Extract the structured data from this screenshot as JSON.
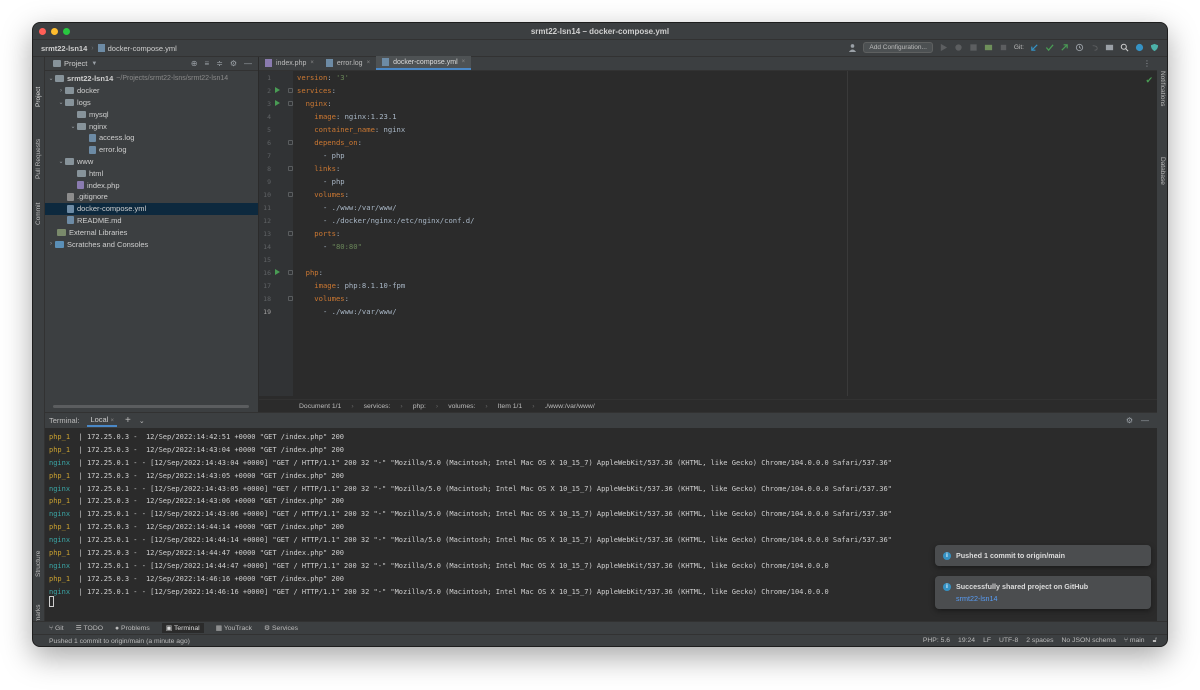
{
  "window": {
    "title": "srmt22-lsn14 – docker-compose.yml"
  },
  "navbar": {
    "project": "srmt22-lsn14",
    "file": "docker-compose.yml",
    "add_configuration": "Add Configuration...",
    "git_label": "Git:"
  },
  "side_tabs": {
    "left_top": [
      "Project",
      "Pull Requests",
      "Commit"
    ],
    "left_bottom": [
      "Structure",
      "Bookmarks"
    ],
    "right": [
      "Notifications",
      "Database"
    ]
  },
  "project_panel": {
    "title": "Project",
    "root": {
      "name": "srmt22-lsn14",
      "path": "~/Projects/srmt22-lsns/srmt22-lsn14"
    },
    "items": [
      "docker",
      "logs",
      "mysql",
      "nginx",
      "access.log",
      "error.log",
      "www",
      "html",
      "index.php",
      ".gitignore",
      "docker-compose.yml",
      "README.md",
      "External Libraries",
      "Scratches and Consoles"
    ]
  },
  "editor_tabs": [
    "index.php",
    "error.log",
    "docker-compose.yml"
  ],
  "code_lines": [
    {
      "n": "1",
      "a": "version",
      "b": ": ",
      "c": "'3'"
    },
    {
      "n": "2",
      "a": "services",
      "b": ":",
      "c": ""
    },
    {
      "n": "3",
      "a": "  nginx",
      "b": ":",
      "c": ""
    },
    {
      "n": "4",
      "a": "    image",
      "b": ": ",
      "c": "nginx:1.23.1"
    },
    {
      "n": "5",
      "a": "    container_name",
      "b": ": ",
      "c": "nginx"
    },
    {
      "n": "6",
      "a": "    depends_on",
      "b": ":",
      "c": ""
    },
    {
      "n": "7",
      "a": "",
      "b": "      - ",
      "c": "php"
    },
    {
      "n": "8",
      "a": "    links",
      "b": ":",
      "c": ""
    },
    {
      "n": "9",
      "a": "",
      "b": "      - ",
      "c": "php"
    },
    {
      "n": "10",
      "a": "    volumes",
      "b": ":",
      "c": ""
    },
    {
      "n": "11",
      "a": "",
      "b": "      - ",
      "c": "./www:/var/www/"
    },
    {
      "n": "12",
      "a": "",
      "b": "      - ",
      "c": "./docker/nginx:/etc/nginx/conf.d/"
    },
    {
      "n": "13",
      "a": "    ports",
      "b": ":",
      "c": ""
    },
    {
      "n": "14",
      "a": "",
      "b": "      - ",
      "c": "\"80:80\""
    },
    {
      "n": "15",
      "a": "",
      "b": "",
      "c": ""
    },
    {
      "n": "16",
      "a": "  php",
      "b": ":",
      "c": ""
    },
    {
      "n": "17",
      "a": "    image",
      "b": ": ",
      "c": "php:8.1.10-fpm"
    },
    {
      "n": "18",
      "a": "    volumes",
      "b": ":",
      "c": ""
    },
    {
      "n": "19",
      "a": "",
      "b": "      - ",
      "c": "./www:/var/www/"
    }
  ],
  "breadcrumbs": [
    "Document 1/1",
    "services:",
    "php:",
    "volumes:",
    "Item 1/1",
    "./www:/var/www/"
  ],
  "terminal": {
    "label": "Terminal:",
    "tab": "Local",
    "lines": [
      {
        "svc": "php_1",
        "text": " | 172.25.0.3 -  12/Sep/2022:14:42:51 +0000 \"GET /index.php\" 200"
      },
      {
        "svc": "php_1",
        "text": " | 172.25.0.3 -  12/Sep/2022:14:43:04 +0000 \"GET /index.php\" 200"
      },
      {
        "svc": "nginx",
        "text": " | 172.25.0.1 - - [12/Sep/2022:14:43:04 +0000] \"GET / HTTP/1.1\" 200 32 \"-\" \"Mozilla/5.0 (Macintosh; Intel Mac OS X 10_15_7) AppleWebKit/537.36 (KHTML, like Gecko) Chrome/104.0.0.0 Safari/537.36\""
      },
      {
        "svc": "php_1",
        "text": " | 172.25.0.3 -  12/Sep/2022:14:43:05 +0000 \"GET /index.php\" 200"
      },
      {
        "svc": "nginx",
        "text": " | 172.25.0.1 - - [12/Sep/2022:14:43:05 +0000] \"GET / HTTP/1.1\" 200 32 \"-\" \"Mozilla/5.0 (Macintosh; Intel Mac OS X 10_15_7) AppleWebKit/537.36 (KHTML, like Gecko) Chrome/104.0.0.0 Safari/537.36\""
      },
      {
        "svc": "php_1",
        "text": " | 172.25.0.3 -  12/Sep/2022:14:43:06 +0000 \"GET /index.php\" 200"
      },
      {
        "svc": "nginx",
        "text": " | 172.25.0.1 - - [12/Sep/2022:14:43:06 +0000] \"GET / HTTP/1.1\" 200 32 \"-\" \"Mozilla/5.0 (Macintosh; Intel Mac OS X 10_15_7) AppleWebKit/537.36 (KHTML, like Gecko) Chrome/104.0.0.0 Safari/537.36\""
      },
      {
        "svc": "php_1",
        "text": " | 172.25.0.3 -  12/Sep/2022:14:44:14 +0000 \"GET /index.php\" 200"
      },
      {
        "svc": "nginx",
        "text": " | 172.25.0.1 - - [12/Sep/2022:14:44:14 +0000] \"GET / HTTP/1.1\" 200 32 \"-\" \"Mozilla/5.0 (Macintosh; Intel Mac OS X 10_15_7) AppleWebKit/537.36 (KHTML, like Gecko) Chrome/104.0.0.0 Safari/537.36\""
      },
      {
        "svc": "php_1",
        "text": " | 172.25.0.3 -  12/Sep/2022:14:44:47 +0000 \"GET /index.php\" 200"
      },
      {
        "svc": "nginx",
        "text": " | 172.25.0.1 - - [12/Sep/2022:14:44:47 +0000] \"GET / HTTP/1.1\" 200 32 \"-\" \"Mozilla/5.0 (Macintosh; Intel Mac OS X 10_15_7) AppleWebKit/537.36 (KHTML, like Gecko) Chrome/104.0.0.0"
      },
      {
        "svc": "php_1",
        "text": " | 172.25.0.3 -  12/Sep/2022:14:46:16 +0000 \"GET /index.php\" 200"
      },
      {
        "svc": "nginx",
        "text": " | 172.25.0.1 - - [12/Sep/2022:14:46:16 +0000] \"GET / HTTP/1.1\" 200 32 \"-\" \"Mozilla/5.0 (Macintosh; Intel Mac OS X 10_15_7) AppleWebKit/537.36 (KHTML, like Gecko) Chrome/104.0.0.0"
      }
    ]
  },
  "notifications": [
    {
      "title": "Pushed 1 commit to origin/main",
      "link": ""
    },
    {
      "title": "Successfully shared project on GitHub",
      "link": "srmt22-lsn14"
    }
  ],
  "toolwindows": [
    "Git",
    "TODO",
    "Problems",
    "Terminal",
    "YouTrack",
    "Services"
  ],
  "status": {
    "message": "Pushed 1 commit to origin/main (a minute ago)",
    "right": [
      "PHP: 5.6",
      "19:24",
      "LF",
      "UTF-8",
      "2 spaces",
      "No JSON schema",
      "main"
    ]
  },
  "colors": {
    "accent": "#4a88c7",
    "keyword": "#cc7832",
    "string": "#6a8759",
    "php_svc": "#c8a030",
    "nginx_svc": "#3aa5a5"
  }
}
